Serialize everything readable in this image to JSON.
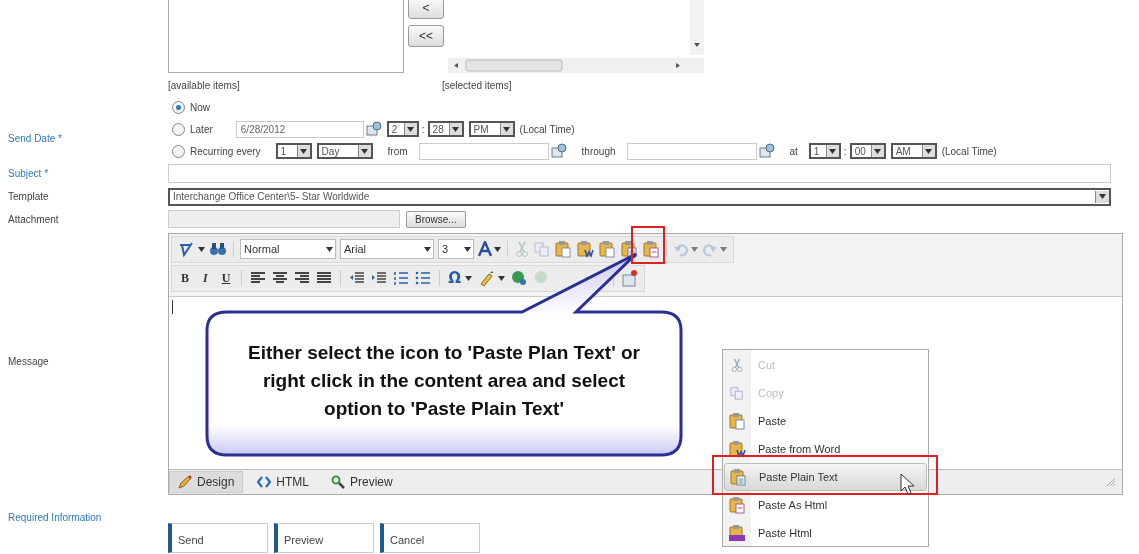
{
  "item_lists": {
    "move_buttons": [
      "<",
      "<<"
    ],
    "available_caption": "[available items]",
    "selected_caption": "[selected items]"
  },
  "send_date": {
    "label": "Send Date *",
    "required": true,
    "options": [
      {
        "label": "Now",
        "selected": true
      },
      {
        "label": "Later",
        "selected": false
      },
      {
        "label": "Recurring every",
        "selected": false
      }
    ],
    "later": {
      "date": "6/28/2012",
      "hour": "2",
      "separator": ":",
      "minute": "28",
      "ampm": "PM",
      "note": "(Local Time)"
    },
    "recurring": {
      "count": "1",
      "unit": "Day",
      "from_label": "from",
      "through_label": "through",
      "at_label": "at",
      "hour": "1",
      "separator": ":",
      "minute": "00",
      "ampm": "AM",
      "note": "(Local Time)"
    }
  },
  "subject": {
    "label": "Subject *",
    "required": true
  },
  "template": {
    "label": "Template",
    "required": false,
    "value": "Interchange Office Center\\5- Star Worldwide"
  },
  "attachment": {
    "label": "Attachment",
    "required": false,
    "button": "Browse..."
  },
  "message": {
    "label": "Message",
    "required": false,
    "toolbar": {
      "paragraph": "Normal",
      "font": "Arial",
      "size": "3",
      "format_buttons": [
        "B",
        "I",
        "U"
      ],
      "special_char": "Ω"
    },
    "modes": [
      {
        "label": "Design",
        "selected": true
      },
      {
        "label": "HTML",
        "selected": false
      },
      {
        "label": "Preview",
        "selected": false
      }
    ]
  },
  "callout": {
    "text": "Either select the icon to 'Paste Plan Text' or right click in the content area and select option to 'Paste Plain Text'"
  },
  "context_menu": [
    {
      "label": "Cut",
      "disabled": true,
      "selected": false
    },
    {
      "label": "Copy",
      "disabled": true,
      "selected": false
    },
    {
      "label": "Paste",
      "disabled": false,
      "selected": false
    },
    {
      "label": "Paste from Word",
      "disabled": false,
      "selected": false
    },
    {
      "label": "Paste Plain Text",
      "disabled": false,
      "selected": true
    },
    {
      "label": "Paste As Html",
      "disabled": false,
      "selected": false
    },
    {
      "label": "Paste Html",
      "disabled": false,
      "selected": false
    }
  ],
  "required_note": "Required Information",
  "buttons": [
    "Send",
    "Preview",
    "Cancel"
  ]
}
